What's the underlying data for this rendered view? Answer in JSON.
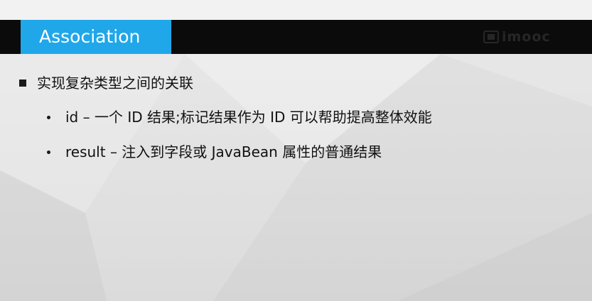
{
  "slide": {
    "title": "Association",
    "logo_text": "imooc",
    "logo_icon": "logo-mark-icon",
    "accent_color": "#1fa7ea",
    "title_bar_color": "#0b0b0b",
    "bullet": {
      "text": "实现复杂类型之间的关联",
      "sub_items": [
        {
          "text": "id – 一个 ID 结果;标记结果作为 ID 可以帮助提高整体效能"
        },
        {
          "text": "result – 注入到字段或 JavaBean 属性的普通结果"
        }
      ]
    }
  }
}
